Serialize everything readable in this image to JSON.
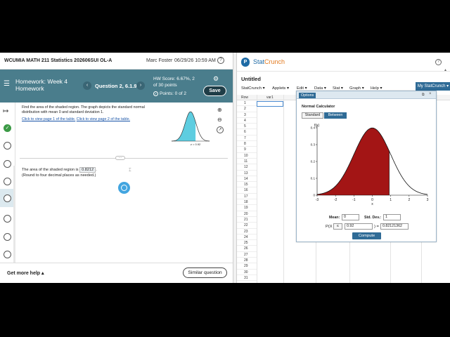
{
  "homework": {
    "course_title": "WCUMIA MATH 211 Statistics 202606SUI OL-A",
    "user_name": "Marc Foster",
    "datetime": "06/29/26 10:59 AM",
    "header": {
      "title_line1": "Homework:  Week 4",
      "title_line2": "Homework",
      "question_label": "Question 2, 6.1.9",
      "hw_score_line1": "HW Score: 6.67%, 2",
      "hw_score_line2": "of 30 points",
      "points": "Points: 0 of 2",
      "save_label": "Save"
    },
    "problem_text": "Find the area of the shaded region. The graph depicts the standard normal distribution with mean 0 and standard deviation 1.",
    "link_page1": "Click to view page 1 of the table.",
    "link_page2": "Click to view page 2 of the table.",
    "z_label": "z = 0.92",
    "answer_prefix": "The area of the shaded region is",
    "answer_value": "0.8212",
    "answer_suffix": ".",
    "round_note": "(Round to four decimal places as needed.)",
    "get_help": "Get more help ▴",
    "similar_question": "Similar question"
  },
  "statcrunch": {
    "brand_stat": "Stat",
    "brand_crunch": "Crunch",
    "doc_title": "Untitled",
    "menus": [
      "StatCrunch ▾",
      "Applets ▾",
      "Edit ▾",
      "Data ▾",
      "Stat ▾",
      "Graph ▾",
      "Help ▾"
    ],
    "my_statcrunch": "My StatCrunch ▾",
    "row_header": "Row",
    "var_header": "var1",
    "rows": [
      "1",
      "2",
      "3",
      "4",
      "5",
      "6",
      "7",
      "8",
      "9",
      "10",
      "11",
      "12",
      "13",
      "14",
      "15",
      "16",
      "17",
      "18",
      "19",
      "20",
      "21",
      "22",
      "23",
      "24",
      "25",
      "26",
      "27",
      "28",
      "29",
      "30",
      "31"
    ],
    "calculator": {
      "options_label": "Options",
      "title": "Normal Calculator",
      "tab_standard": "Standard",
      "tab_between": "Between",
      "mean_label": "Mean:",
      "mean_value": "0",
      "sd_label": "Std. Dev.:",
      "sd_value": "1",
      "px_label": "P(X",
      "inequality": "≤",
      "x_value": "0.92",
      "result_prefix": ") =",
      "result_value": "0.82121362",
      "compute_label": "Compute"
    }
  },
  "chart_data": {
    "type": "area",
    "distribution": "normal",
    "mean": 0,
    "sd": 1,
    "shaded_upper": 0.92,
    "xlabel": "x",
    "ylabel": "f(x)",
    "xlim": [
      -3,
      3
    ],
    "ylim": [
      0,
      0.4
    ],
    "x_ticks": [
      "-3",
      "-2",
      "-1",
      "0",
      "1",
      "2",
      "3"
    ],
    "y_ticks": [
      "0",
      "0.1",
      "0.2",
      "0.3",
      "0.4"
    ],
    "fill_color": "#a31515"
  }
}
